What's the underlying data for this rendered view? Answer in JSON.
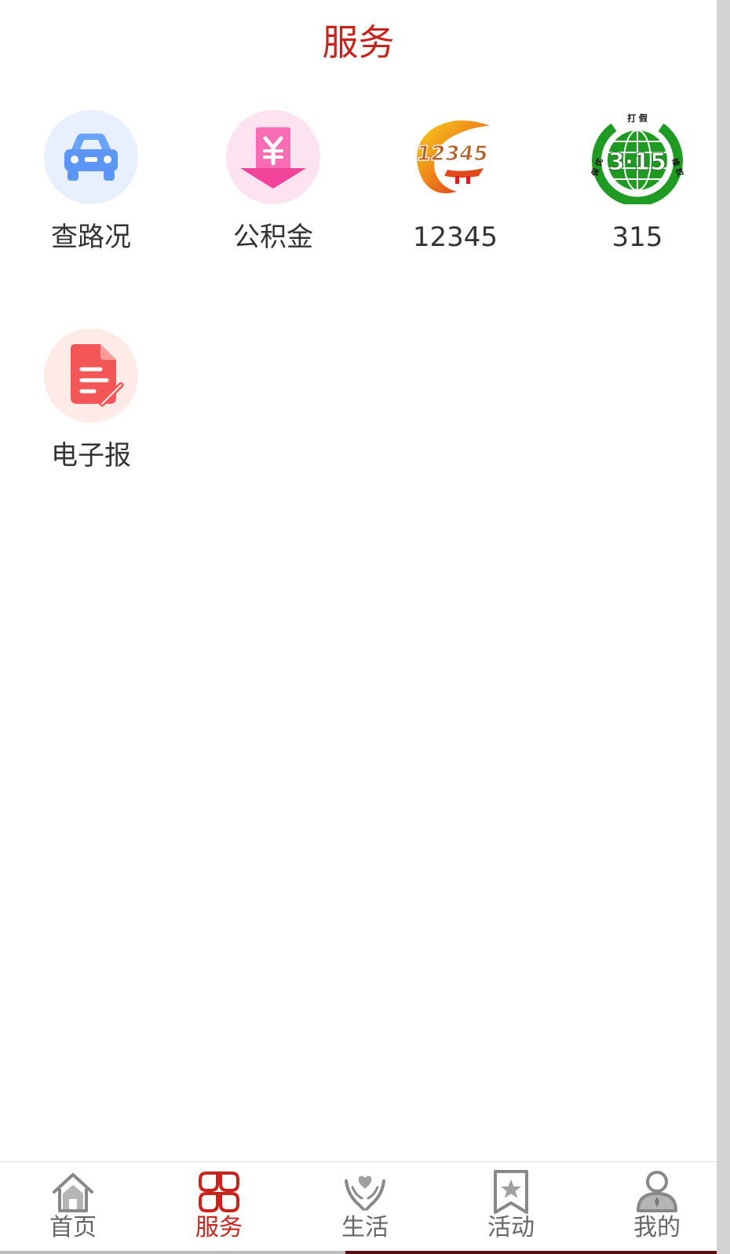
{
  "header": {
    "title": "服务"
  },
  "services": [
    {
      "label": "查路况",
      "icon": "car-icon"
    },
    {
      "label": "公积金",
      "icon": "yuan-fund-icon"
    },
    {
      "label": "12345",
      "icon": "hotline-12345-logo"
    },
    {
      "label": "315",
      "icon": "consumer-rights-315-logo",
      "logo_text": {
        "top": "打 假",
        "center": "3·15",
        "left": "保 优",
        "right": "维 权"
      }
    },
    {
      "label": "电子报",
      "icon": "e-newspaper-icon"
    }
  ],
  "tabbar": {
    "items": [
      {
        "label": "首页",
        "icon": "home-icon",
        "active": false
      },
      {
        "label": "服务",
        "icon": "services-grid-icon",
        "active": true
      },
      {
        "label": "生活",
        "icon": "heart-hands-icon",
        "active": false
      },
      {
        "label": "活动",
        "icon": "star-bookmark-icon",
        "active": false
      },
      {
        "label": "我的",
        "icon": "user-icon",
        "active": false
      }
    ]
  },
  "colors": {
    "accent": "#c8241d",
    "text": "#333333",
    "tab_inactive": "#666666",
    "car_bg": "#e8f0fe",
    "car": "#5b96f7",
    "fund_bg": "#fde3f0",
    "fund": "#f2449a",
    "news_bg": "#feebe8",
    "news": "#f25656",
    "green_315": "#1f9a22"
  }
}
